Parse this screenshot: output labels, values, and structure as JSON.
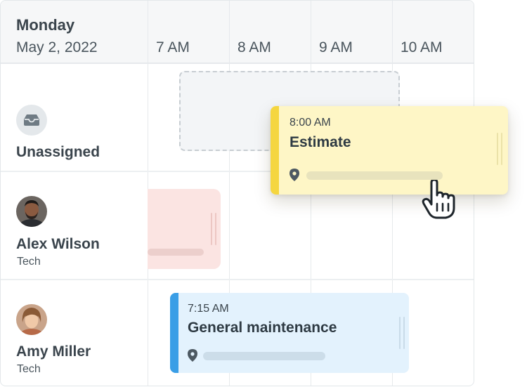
{
  "schedule": {
    "day": "Monday",
    "date": "May 2, 2022",
    "time_slots": [
      "7 AM",
      "8 AM",
      "9 AM",
      "10 AM"
    ]
  },
  "rows": [
    {
      "name": "Unassigned",
      "icon": "inbox-icon"
    },
    {
      "name": "Alex Wilson",
      "role": "Tech",
      "avatar": "avatar-alex"
    },
    {
      "name": "Amy Miller",
      "role": "Tech",
      "avatar": "avatar-amy"
    }
  ],
  "jobs": {
    "dragging": {
      "time": "8:00 AM",
      "title": "Estimate",
      "color": "#fef6c6",
      "accent": "#f5d640"
    },
    "maintenance": {
      "time": "7:15 AM",
      "title": "General maintenance",
      "color": "#e3f2fd",
      "accent": "#3a9ee6"
    },
    "alex_partial": {
      "color": "#fbe4e2"
    }
  },
  "icons": [
    "inbox-icon",
    "map-pin-icon",
    "drag-handle-icon",
    "hand-pointer-icon"
  ]
}
